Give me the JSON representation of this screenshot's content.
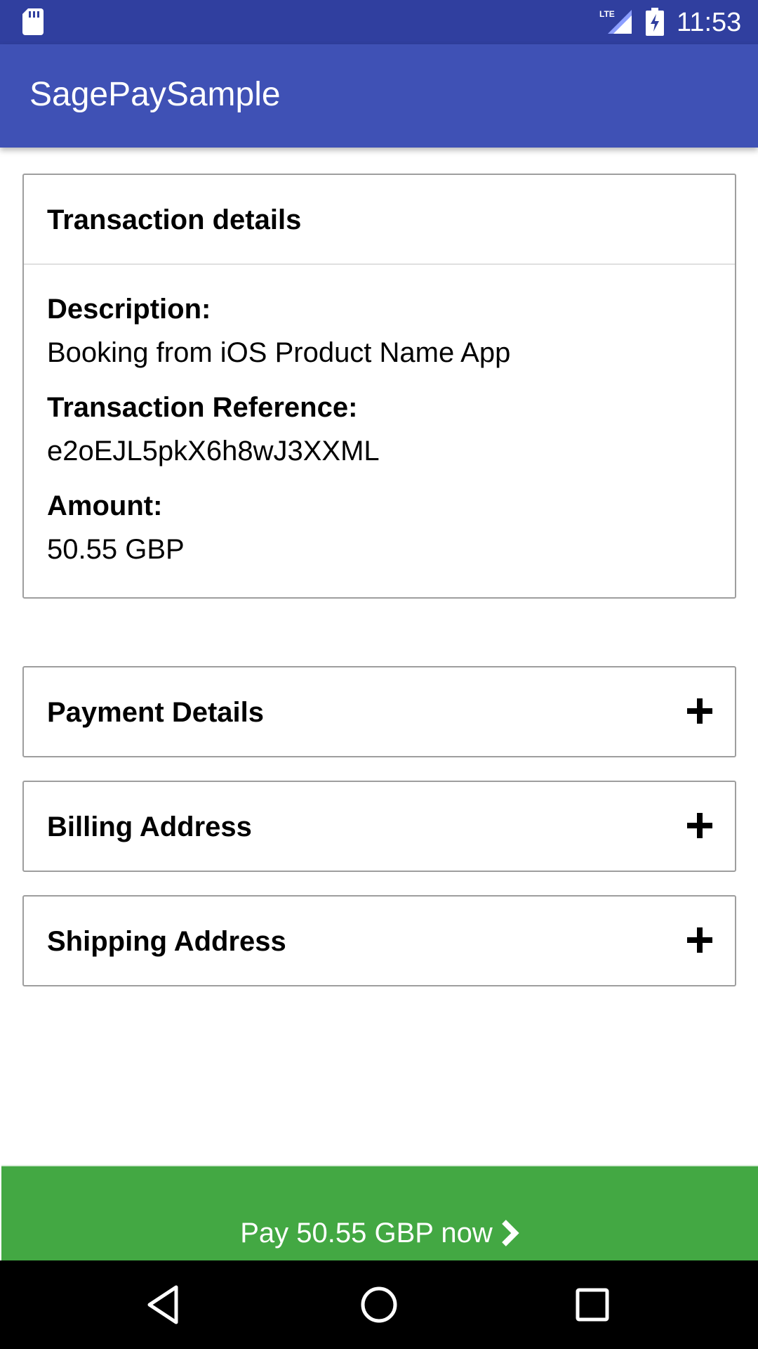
{
  "status_bar": {
    "time": "11:53",
    "network_label": "LTE",
    "icons": [
      "sd-card-icon",
      "lte-signal-icon",
      "battery-charging-icon"
    ]
  },
  "app_bar": {
    "title": "SagePaySample"
  },
  "transaction": {
    "header": "Transaction details",
    "fields": [
      {
        "label": "Description:",
        "value": "Booking from iOS Product Name App"
      },
      {
        "label": "Transaction Reference:",
        "value": "e2oEJL5pkX6h8wJ3XXML"
      },
      {
        "label": "Amount:",
        "value": "50.55 GBP"
      }
    ]
  },
  "sections": [
    {
      "title": "Payment Details",
      "icon": "plus-icon",
      "expanded": false
    },
    {
      "title": "Billing Address",
      "icon": "plus-icon",
      "expanded": false
    },
    {
      "title": "Shipping Address",
      "icon": "plus-icon",
      "expanded": false
    }
  ],
  "pay_button": {
    "label": "Pay 50.55 GBP now",
    "icon": "chevron-right-icon"
  },
  "nav_bar": {
    "buttons": [
      "back-icon",
      "home-icon",
      "recents-icon"
    ]
  },
  "colors": {
    "status_bar": "#303f9f",
    "app_bar": "#3f51b5",
    "pay_button": "#43a843",
    "card_border": "#9e9e9e",
    "nav_bar": "#000000"
  }
}
